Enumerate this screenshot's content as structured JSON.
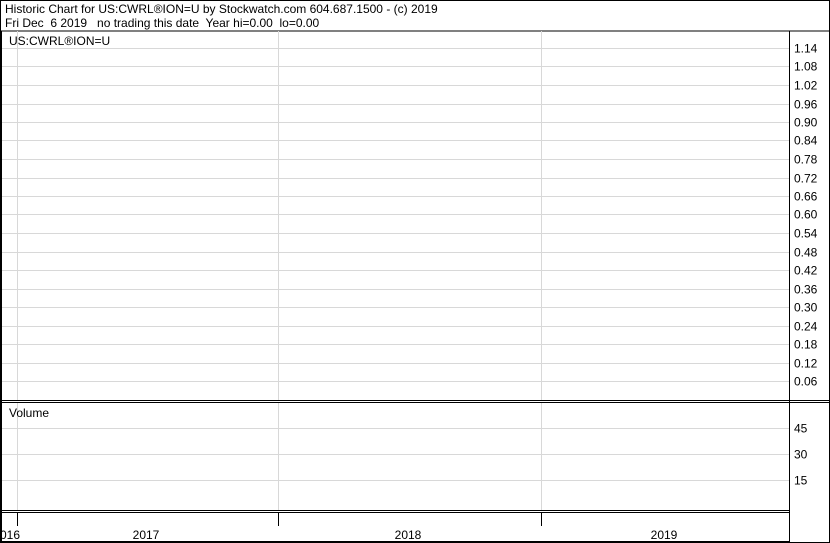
{
  "header": {
    "line1": "Historic Chart for US:CWRL®ION=U by Stockwatch.com 604.687.1500 - (c) 2019",
    "line2": "Fri Dec  6 2019   no trading this date  Year hi=0.00  lo=0.00"
  },
  "price_panel": {
    "symbol": "US:CWRL®ION=U"
  },
  "volume_panel": {
    "title": "Volume"
  },
  "chart_data": [
    {
      "type": "line",
      "title": "US:CWRL®ION=U",
      "x_tick_labels": [
        "016",
        "2017",
        "2018",
        "2019"
      ],
      "y_ticks": [
        1.14,
        1.08,
        1.02,
        0.96,
        0.9,
        0.84,
        0.78,
        0.72,
        0.66,
        0.6,
        0.54,
        0.48,
        0.42,
        0.36,
        0.3,
        0.24,
        0.18,
        0.12,
        0.06
      ],
      "ylim": [
        0,
        1.2
      ],
      "grid": true,
      "series": []
    },
    {
      "type": "bar",
      "title": "Volume",
      "y_ticks": [
        45,
        30,
        15
      ],
      "ylim": [
        0,
        60
      ],
      "grid": true,
      "series": []
    }
  ],
  "colors": {
    "grid": "#d8d8d8",
    "frame": "#000000",
    "background": "#ffffff"
  }
}
